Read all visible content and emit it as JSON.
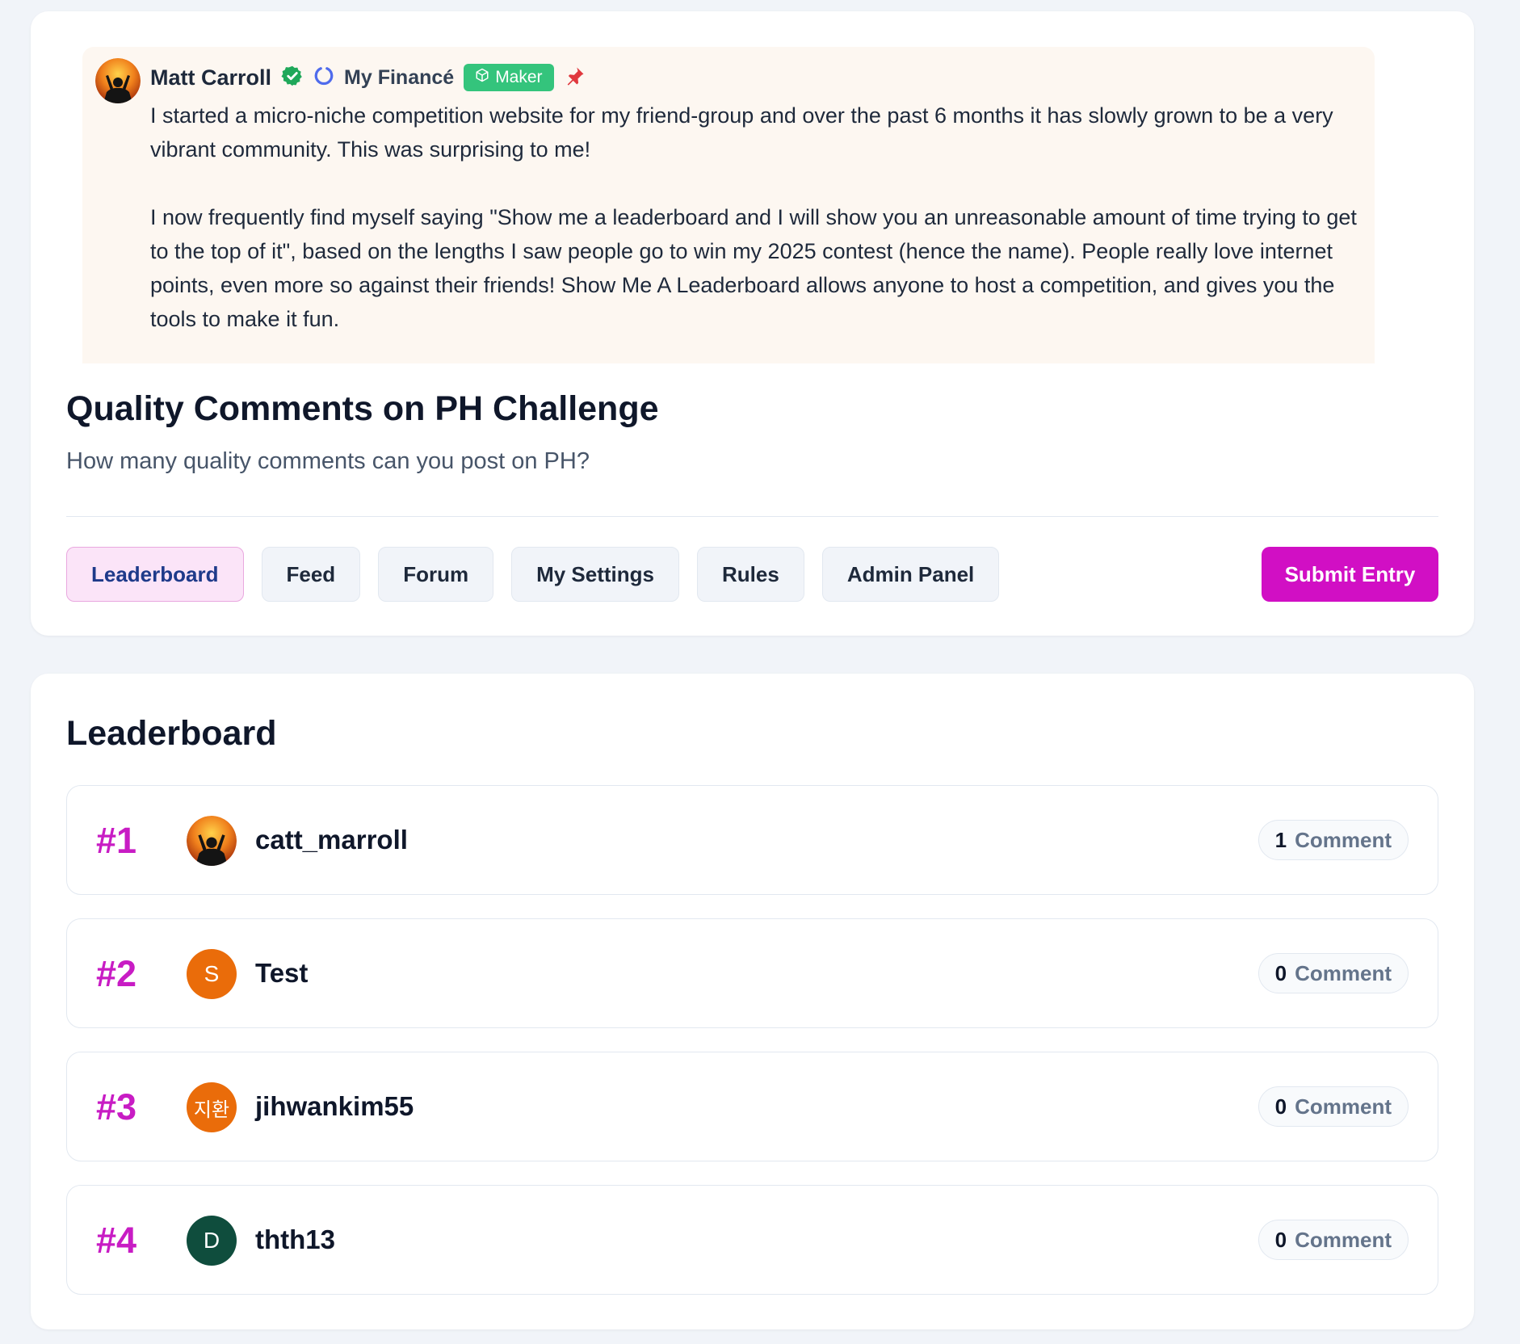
{
  "post": {
    "author": "Matt Carroll",
    "product": "My Financé",
    "badge": "Maker",
    "body": [
      "I started a micro-niche competition website for my friend-group and over the past 6 months it has slowly grown to be a very vibrant community. This was surprising to me!",
      "I now frequently find myself saying \"Show me a leaderboard and I will show you an unreasonable amount of time trying to get to the top of it\", based on the lengths I saw people go to win my 2025 contest (hence the name). People really love internet points, even more so against their friends! Show Me A Leaderboard allows anyone to host a competition, and gives you the tools to make it fun."
    ],
    "icons": [
      "verified-icon",
      "product-ring-icon",
      "cube-icon",
      "pin-icon"
    ]
  },
  "challenge": {
    "title": "Quality Comments on PH Challenge",
    "subtitle": "How many quality comments can you post on PH?"
  },
  "tabs": [
    "Leaderboard",
    "Feed",
    "Forum",
    "My Settings",
    "Rules",
    "Admin Panel"
  ],
  "active_tab": "Leaderboard",
  "submit_label": "Submit Entry",
  "leaderboard": {
    "title": "Leaderboard",
    "rows": [
      {
        "rank": "#1",
        "name": "catt_marroll",
        "avatar": "photo",
        "count": "1",
        "unit": "Comment"
      },
      {
        "rank": "#2",
        "name": "Test",
        "avatar": "S",
        "avatar_color": "#ea6c0a",
        "count": "0",
        "unit": "Comment"
      },
      {
        "rank": "#3",
        "name": "jihwankim55",
        "avatar": "지환",
        "avatar_color": "#ea6c0a",
        "count": "0",
        "unit": "Comment"
      },
      {
        "rank": "#4",
        "name": "thth13",
        "avatar": "D",
        "avatar_color": "#0f4d3d",
        "count": "0",
        "unit": "Comment"
      }
    ]
  },
  "colors": {
    "accent": "#d10fc4",
    "rank": "#c81cc4",
    "maker_badge": "#34c47c",
    "post_background": "#fdf7f1"
  }
}
